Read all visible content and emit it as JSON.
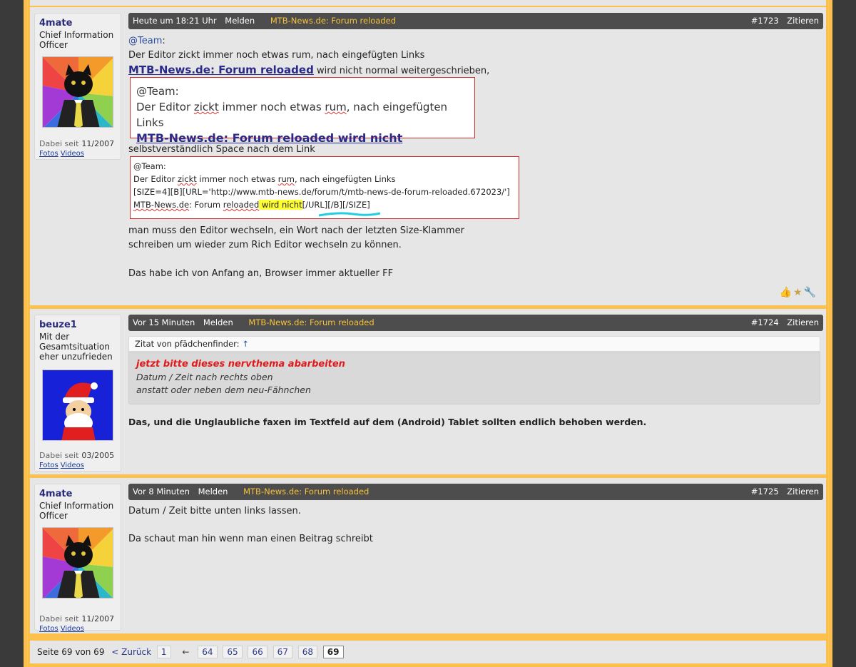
{
  "posts": [
    {
      "user": {
        "name": "4mate",
        "title": "Chief Information Officer",
        "since_label": "Dabei seit",
        "since": "11/2007",
        "link_photos": "Fotos",
        "link_videos": "Videos"
      },
      "bar": {
        "time": "Heute um 18:21 Uhr",
        "report": "Melden",
        "thread": "MTB-News.de: Forum reloaded",
        "number": "#1723",
        "quote": "Zitieren"
      },
      "lines": {
        "l1": "@Team",
        "l1b": ":",
        "l2": "Der Editor zickt immer noch etwas rum, nach eingefügten Links",
        "l3_link": "MTB-News.de: Forum reloaded",
        "l3_rest": " wird nicht normal weitergeschrieben,",
        "box1_l1": "@Team:",
        "box1_l2a": "Der Editor ",
        "box1_l2b": "zickt",
        "box1_l2c": " immer noch etwas ",
        "box1_l2d": "rum",
        "box1_l2e": ", nach eingefügten Links",
        "box1_l3": "MTB-News.de: Forum reloaded wird nicht",
        "l4": "selbstverständlich Space nach dem Link",
        "box2_l1": "@Team:",
        "box2_l2a": "Der Editor ",
        "box2_l2b": "zickt",
        "box2_l2c": " immer noch etwas ",
        "box2_l2d": "rum",
        "box2_l2e": ", nach eingefügten Links",
        "box2_l3": "[SIZE=4][B][URL='http://www.mtb-news.de/forum/t/mtb-news-de-forum-reloaded.672023/']",
        "box2_l4a": "MTB-News.de",
        "box2_l4b": ": Forum ",
        "box2_l4c": "reloaded",
        "box2_l4d": " wird nicht",
        "box2_l4e": "[/URL][/B][/SIZE]",
        "l5": "man muss den Editor wechseln, ein Wort nach der letzten Size-Klammer",
        "l6": "schreiben um wieder zum Rich Editor wechseln zu können.",
        "l7": "Das habe ich von Anfang an, Browser immer aktueller FF"
      }
    },
    {
      "user": {
        "name": "beuze1",
        "title": "Mit der Gesamtsituation eher unzufrieden",
        "since_label": "Dabei seit",
        "since": "03/2005",
        "link_photos": "Fotos",
        "link_videos": "Videos"
      },
      "bar": {
        "time": "Vor 15 Minuten",
        "report": "Melden",
        "thread": "MTB-News.de: Forum reloaded",
        "number": "#1724",
        "quote": "Zitieren"
      },
      "quote_head": "Zitat von pfädchenfinder:",
      "quote_arrow": "↑",
      "quote_red": "jetzt bitte dieses nervthema abarbeiten",
      "quote_l2": "Datum / Zeit nach rechts oben",
      "quote_l3": "anstatt oder neben dem neu-Fähnchen",
      "text": "Das, und die Unglaubliche faxen im Textfeld auf dem (Android) Tablet sollten endlich behoben werden."
    },
    {
      "user": {
        "name": "4mate",
        "title": "Chief Information Officer",
        "since_label": "Dabei seit",
        "since": "11/2007",
        "link_photos": "Fotos",
        "link_videos": "Videos"
      },
      "bar": {
        "time": "Vor 8 Minuten",
        "report": "Melden",
        "thread": "MTB-News.de: Forum reloaded",
        "number": "#1725",
        "quote": "Zitieren"
      },
      "l1": "Datum / Zeit bitte unten links lassen.",
      "l2": "Da schaut man hin wenn man einen Beitrag schreibt"
    }
  ],
  "post_icons": [
    "thumbs-up-icon",
    "star-icon",
    "wrench-icon"
  ],
  "pager": {
    "label": "Seite 69 von 69",
    "prev": "< Zurück",
    "first": "1",
    "ellipsis": "←",
    "pages": [
      "64",
      "65",
      "66",
      "67",
      "68"
    ],
    "current": "69"
  },
  "colors": {
    "accent": "#fcc14d",
    "bar": "#4d4d4d",
    "thread": "#f7c23a",
    "highlight": "#ffff33"
  }
}
